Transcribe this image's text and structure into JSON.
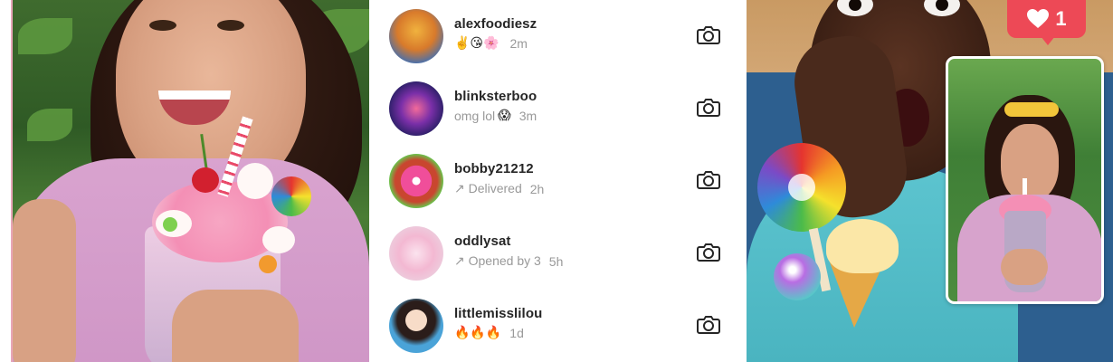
{
  "conversations": [
    {
      "username": "alexfoodiesz",
      "emoji": "✌️😘🌸",
      "status": "",
      "time": "2m",
      "avatar_icon": "avatar-alexfoodiesz"
    },
    {
      "username": "blinksterboo",
      "emoji": "😱",
      "status": "omg lol",
      "time": "3m",
      "avatar_icon": "avatar-blinksterboo"
    },
    {
      "username": "bobby21212",
      "emoji": "",
      "status": "↗ Delivered",
      "time": "2h",
      "avatar_icon": "avatar-bobby21212"
    },
    {
      "username": "oddlysat",
      "emoji": "",
      "status": "↗ Opened by 3",
      "time": "5h",
      "avatar_icon": "avatar-oddlysat"
    },
    {
      "username": "littlemisslilou",
      "emoji": "🔥🔥🔥",
      "status": "",
      "time": "1d",
      "avatar_icon": "avatar-littlemisslilou"
    }
  ],
  "like_badge": {
    "icon": "heart-icon",
    "count": "1"
  },
  "colors": {
    "like_red": "#ed4956",
    "text_primary": "#262626",
    "text_secondary": "#999999"
  }
}
